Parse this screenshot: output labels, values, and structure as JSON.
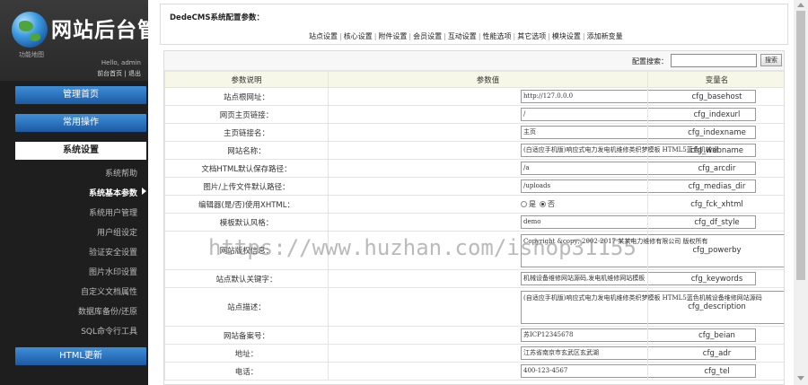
{
  "sidebar": {
    "logo_title": "网站后台管",
    "nav_map": "功能地图",
    "hello": "Hello, admin",
    "links": {
      "home": "前台首页",
      "sep": " | ",
      "logout": "退出"
    },
    "menu_home": "管理首页",
    "menu_common": "常用操作",
    "menu_system": "系统设置",
    "sub_items": [
      "系统帮助",
      "系统基本参数",
      "系统用户管理",
      "用户组设定",
      "验证安全设置",
      "图片水印设置",
      "自定义文档属性",
      "数据库备份/还原",
      "SQL命令行工具"
    ],
    "menu_html": "HTML更新"
  },
  "main": {
    "config_title": "DedeCMS系统配置参数：",
    "tabs": [
      "站点设置",
      "核心设置",
      "附件设置",
      "会员设置",
      "互动设置",
      "性能选项",
      "其它选项",
      "模块设置",
      "添加新变量"
    ],
    "search_label": "配置搜索：",
    "search_value": "",
    "search_button": "搜索",
    "columns": [
      "参数说明",
      "参数值",
      "变量名"
    ],
    "rows": [
      {
        "label": "站点根网址：",
        "value": "http://127.0.0.0",
        "var": "cfg_basehost"
      },
      {
        "label": "网页主页链接：",
        "value": "/",
        "var": "cfg_indexurl"
      },
      {
        "label": "主页链接名：",
        "value": "主页",
        "var": "cfg_indexname"
      },
      {
        "label": "网站名称：",
        "value": "(白适应手机版)响应式电力发电机维修类织梦模板 HTML5蓝色机械设",
        "var": "cfg_webname"
      },
      {
        "label": "文档HTML默认保存路径：",
        "value": "/a",
        "var": "cfg_arcdir"
      },
      {
        "label": "图片/上传文件默认路径：",
        "value": "/uploads",
        "var": "cfg_medias_dir"
      },
      {
        "label": "编辑器(是/否)使用XHTML：",
        "value": "",
        "var": "cfg_fck_xhtml",
        "radio": {
          "yes": "是",
          "no": "否",
          "selected": "no"
        }
      },
      {
        "label": "模板默认风格：",
        "value": "demo",
        "var": "cfg_df_style"
      },
      {
        "label": "网站版权信息：",
        "value": "Copyright &copy; 2002-2017 某某电力维修有限公司 版权所有",
        "var": "cfg_powerby",
        "area": true
      },
      {
        "label": "站点默认关键字：",
        "value": "机械设备维修网站源码,发电机维修网站模板",
        "var": "cfg_keywords"
      },
      {
        "label": "站点描述：",
        "value": "(自适应手机版)响应式电力发电机维修类织梦模板 HTML5蓝色机械设备维修网站源码",
        "var": "cfg_description",
        "area": true
      },
      {
        "label": "网站备案号：",
        "value": "苏ICP12345678",
        "var": "cfg_beian"
      },
      {
        "label": "地址：",
        "value": "江苏省南京市玄武区玄武湖",
        "var": "cfg_adr"
      },
      {
        "label": "电话：",
        "value": "400-123-4567",
        "var": "cfg_tel"
      }
    ]
  },
  "watermark": "https://www.huzhan.com/ishop31155"
}
